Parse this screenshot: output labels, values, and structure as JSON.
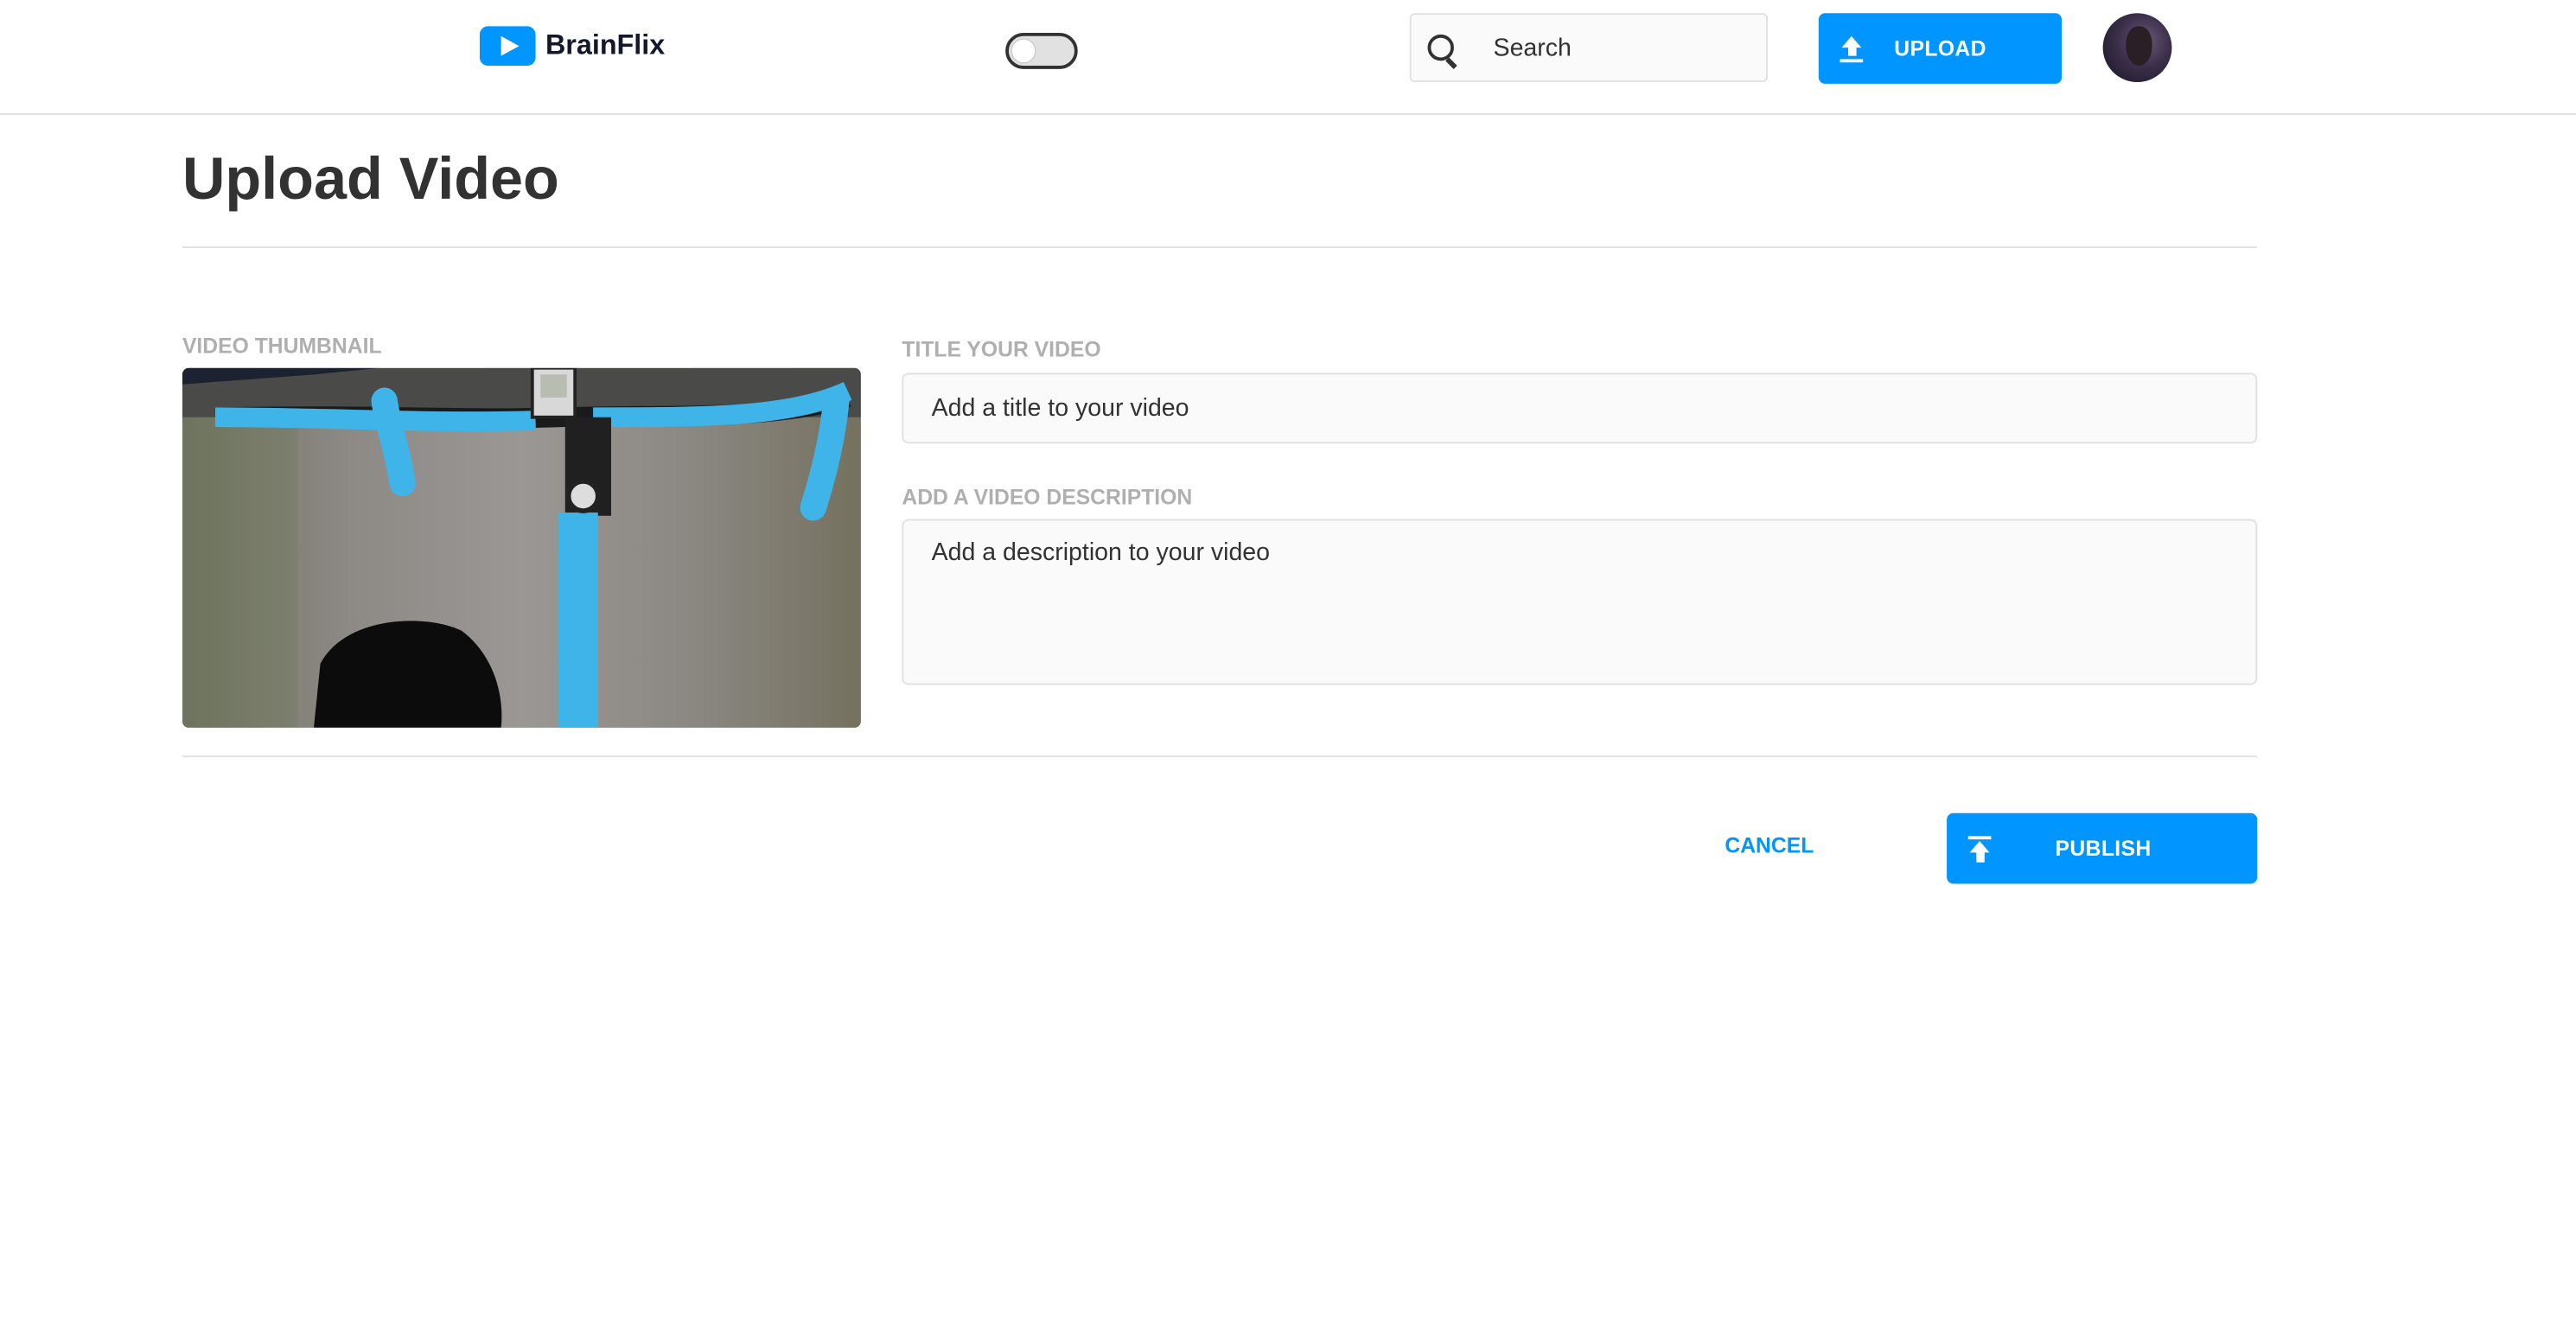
{
  "header": {
    "logo_text": "BrainFlix",
    "theme_toggle": {
      "state": "off"
    },
    "search": {
      "placeholder": "Search"
    },
    "upload_label": "UPLOAD"
  },
  "main": {
    "page_title": "Upload Video",
    "thumbnail_label": "VIDEO THUMBNAIL",
    "title_label": "TITLE YOUR VIDEO",
    "title_placeholder": "Add a title to your video",
    "description_label": "ADD A VIDEO DESCRIPTION",
    "description_placeholder": "Add a description to your video",
    "cancel_label": "CANCEL",
    "publish_label": "PUBLISH"
  },
  "colors": {
    "accent": "#0095ff",
    "text": "#323232",
    "label": "#afafaf",
    "border": "#e1e1e1",
    "field_bg": "#fafafa",
    "bike_tape": "#3fb4e8"
  },
  "icons": [
    "video-logo-icon",
    "search-icon",
    "upload-icon",
    "publish-icon"
  ]
}
